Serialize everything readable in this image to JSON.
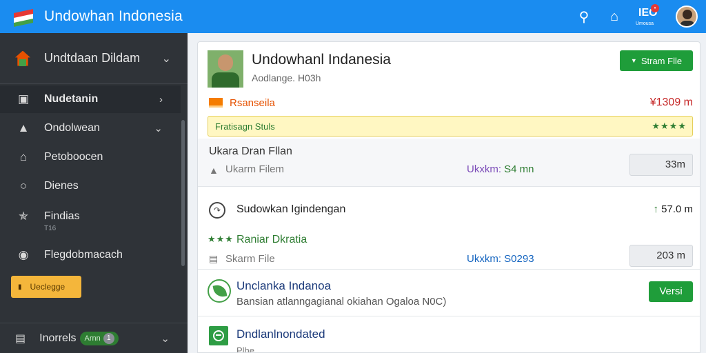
{
  "app": {
    "title": "Undowhan Indonesia"
  },
  "topbar": {
    "icons": [
      "key-icon",
      "home-icon",
      "notification-icon"
    ],
    "notification_label": "IEO",
    "notification_caption": "Umousa"
  },
  "sidebar": {
    "header": {
      "label": "Undtdaan Dildam"
    },
    "items": [
      {
        "label": "Nudetanin",
        "icon": "image-icon",
        "active": true
      },
      {
        "label": "Ondolwean",
        "icon": "bell-icon"
      },
      {
        "label": "Petoboocen",
        "icon": "home-icon"
      },
      {
        "label": "Dienes",
        "icon": "circle-icon"
      },
      {
        "label": "Findias",
        "icon": "puzzle-icon",
        "sub": "T16"
      },
      {
        "label": "Flegdobmacach",
        "icon": "location-icon"
      }
    ],
    "upgrade_label": "Ueclegge",
    "footer": {
      "label": "Inorrels",
      "badge_text": "Arnn",
      "badge_count": "1"
    }
  },
  "main": {
    "header": {
      "title": "Undowhanl Indanesia",
      "subtitle": "Aodlange. H03h",
      "stream_button": "Stram Flle"
    },
    "region": {
      "name": "Rsanseila",
      "value": "¥1309 m"
    },
    "notice": {
      "text": "Fratisagn Stuls",
      "stars": "★★★★"
    },
    "cards": [
      {
        "title": "Ukara Dran Fllan",
        "sub": "Ukarm Filem",
        "stat_key": "Ukxkm:",
        "stat_val": "S4 mn",
        "size": "33m"
      },
      {
        "title": "Sudowkan Igindengan",
        "value": "57.0 m",
        "stars": "★★★",
        "rating_name": "Raniar Dkratia",
        "sub": "Skarm File",
        "stat_key": "Ukxkm:",
        "stat_val": "S0293",
        "size": "203 m"
      },
      {
        "title": "Unclanka Indanoa",
        "sub": "Bansian atlanngagianal okiahan Ogaloa N0C)",
        "button": "Versi"
      },
      {
        "title": "Dndlanlnondated",
        "sub": "Plhe"
      }
    ]
  },
  "colors": {
    "topbar": "#1a8cf0",
    "sidebar": "#2f3338",
    "accent_green": "#1f9d3a",
    "upgrade_yellow": "#f4b63b",
    "region_orange": "#e65100",
    "value_red": "#c62828"
  }
}
